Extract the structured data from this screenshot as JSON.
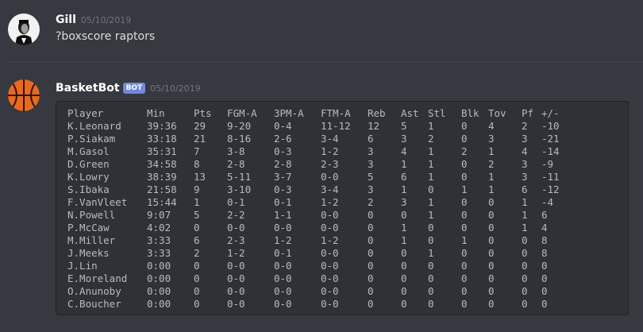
{
  "messages": [
    {
      "username": "Gill",
      "timestamp": "05/10/2019",
      "text": "?boxscore raptors",
      "avatar": "godfather-portrait-avatar"
    },
    {
      "username": "BasketBot",
      "bot_tag": "BOT",
      "timestamp": "05/10/2019",
      "avatar": "basketball-avatar"
    }
  ],
  "colors": {
    "background": "#36393f",
    "codeblock": "#2f3136",
    "bot_tag": "#7289da",
    "basketball": "#e8691f"
  },
  "boxscore": {
    "headers": [
      "Player",
      "Min",
      "Pts",
      "FGM-A",
      "3PM-A",
      "FTM-A",
      "Reb",
      "Ast",
      "Stl",
      "Blk",
      "Tov",
      "Pf",
      "+/-"
    ],
    "rows": [
      [
        "K.Leonard",
        "39:36",
        "29",
        "9-20",
        "0-4",
        "11-12",
        "12",
        "5",
        "1",
        "0",
        "4",
        "2",
        "-10"
      ],
      [
        "P.Siakam",
        "33:18",
        "21",
        "8-16",
        "2-6",
        "3-4",
        "6",
        "3",
        "2",
        "0",
        "3",
        "3",
        "-21"
      ],
      [
        "M.Gasol",
        "35:31",
        "7",
        "3-8",
        "0-3",
        "1-2",
        "3",
        "4",
        "1",
        "2",
        "1",
        "4",
        "-14"
      ],
      [
        "D.Green",
        "34:58",
        "8",
        "2-8",
        "2-8",
        "2-3",
        "3",
        "1",
        "1",
        "0",
        "2",
        "3",
        "-9"
      ],
      [
        "K.Lowry",
        "38:39",
        "13",
        "5-11",
        "3-7",
        "0-0",
        "5",
        "6",
        "1",
        "0",
        "1",
        "3",
        "-11"
      ],
      [
        "S.Ibaka",
        "21:58",
        "9",
        "3-10",
        "0-3",
        "3-4",
        "3",
        "1",
        "0",
        "1",
        "1",
        "6",
        "-12"
      ],
      [
        "F.VanVleet",
        "15:44",
        "1",
        "0-1",
        "0-1",
        "1-2",
        "2",
        "3",
        "1",
        "0",
        "0",
        "1",
        "-4"
      ],
      [
        "N.Powell",
        "9:07",
        "5",
        "2-2",
        "1-1",
        "0-0",
        "0",
        "0",
        "1",
        "0",
        "0",
        "1",
        "6"
      ],
      [
        "P.McCaw",
        "4:02",
        "0",
        "0-0",
        "0-0",
        "0-0",
        "0",
        "1",
        "0",
        "0",
        "0",
        "1",
        "4"
      ],
      [
        "M.Miller",
        "3:33",
        "6",
        "2-3",
        "1-2",
        "1-2",
        "0",
        "1",
        "0",
        "1",
        "0",
        "0",
        "8"
      ],
      [
        "J.Meeks",
        "3:33",
        "2",
        "1-2",
        "0-1",
        "0-0",
        "0",
        "0",
        "1",
        "0",
        "0",
        "0",
        "8"
      ],
      [
        "J.Lin",
        "0:00",
        "0",
        "0-0",
        "0-0",
        "0-0",
        "0",
        "0",
        "0",
        "0",
        "0",
        "0",
        "0"
      ],
      [
        "E.Moreland",
        "0:00",
        "0",
        "0-0",
        "0-0",
        "0-0",
        "0",
        "0",
        "0",
        "0",
        "0",
        "0",
        "0"
      ],
      [
        "O.Anunoby",
        "0:00",
        "0",
        "0-0",
        "0-0",
        "0-0",
        "0",
        "0",
        "0",
        "0",
        "0",
        "0",
        "0"
      ],
      [
        "C.Boucher",
        "0:00",
        "0",
        "0-0",
        "0-0",
        "0-0",
        "0",
        "0",
        "0",
        "0",
        "0",
        "0",
        "0"
      ]
    ]
  }
}
